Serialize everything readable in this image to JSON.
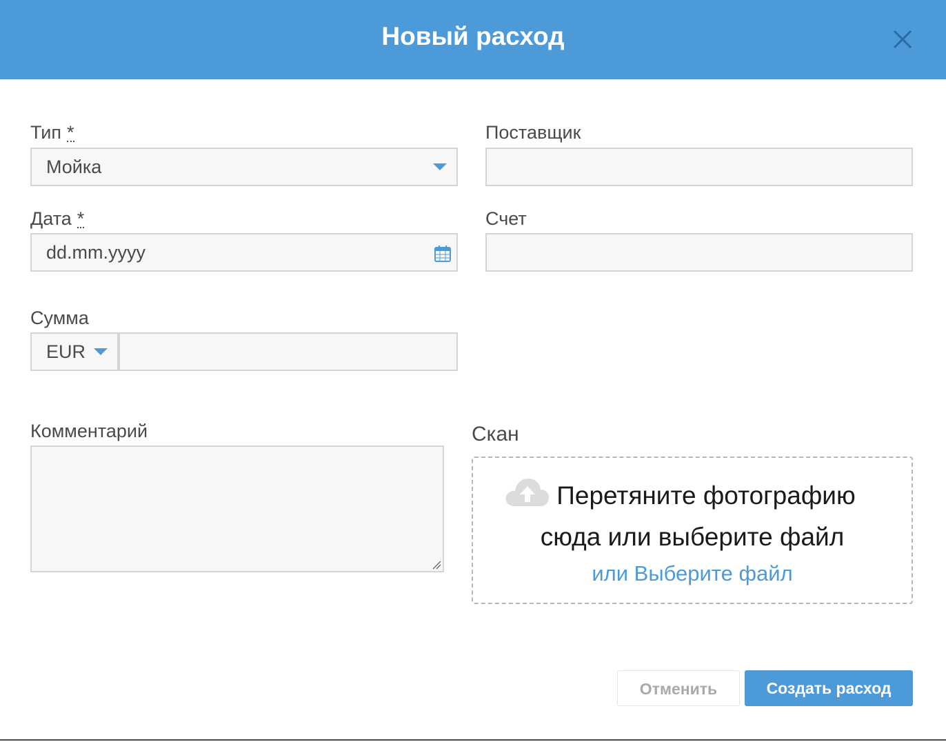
{
  "modal": {
    "title": "Новый расход",
    "close_icon": "close-icon"
  },
  "form": {
    "type": {
      "label": "Тип",
      "required_mark": "*",
      "value": "Мойка"
    },
    "supplier": {
      "label": "Поставщик",
      "value": ""
    },
    "date": {
      "label": "Дата",
      "required_mark": "*",
      "placeholder": "dd.mm.yyyy",
      "icon": "calendar-icon"
    },
    "invoice": {
      "label": "Счет",
      "value": ""
    },
    "amount": {
      "label": "Сумма",
      "currency": "EUR",
      "value": ""
    },
    "comment": {
      "label": "Комментарий",
      "value": ""
    },
    "scan": {
      "label": "Скан",
      "icon": "cloud-upload-icon",
      "drop_text_line1": "Перетяните фотографию",
      "drop_text_line2": "сюда или выберите файл",
      "choose_link": "или Выберите файл"
    }
  },
  "footer": {
    "cancel_label": "Отменить",
    "create_label": "Создать расход"
  },
  "colors": {
    "accent": "#4d9ad8",
    "field_bg": "#f7f7f7",
    "field_border": "#d5d5d5",
    "text": "#4a4a4a"
  }
}
